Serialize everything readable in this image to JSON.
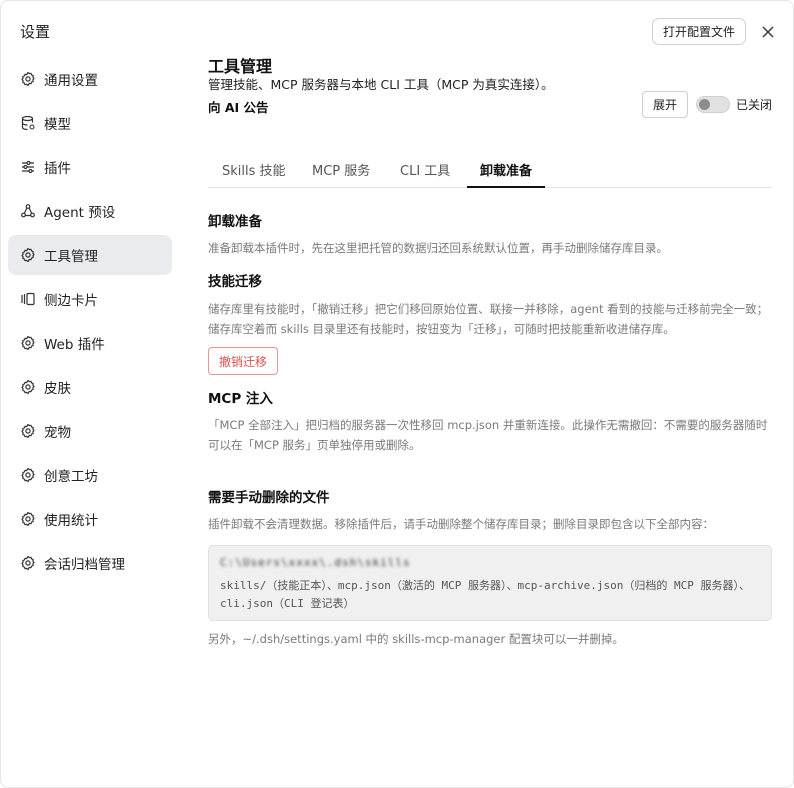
{
  "sidebar": {
    "title": "设置",
    "items": [
      {
        "label": "通用设置",
        "icon": "gear-icon"
      },
      {
        "label": "模型",
        "icon": "database-icon"
      },
      {
        "label": "插件",
        "icon": "sliders-icon"
      },
      {
        "label": "Agent 预设",
        "icon": "agent-icon"
      },
      {
        "label": "工具管理",
        "icon": "gear-icon"
      },
      {
        "label": "侧边卡片",
        "icon": "cards-icon"
      },
      {
        "label": "Web 插件",
        "icon": "gear-icon"
      },
      {
        "label": "皮肤",
        "icon": "gear-icon"
      },
      {
        "label": "宠物",
        "icon": "gear-icon"
      },
      {
        "label": "创意工坊",
        "icon": "gear-icon"
      },
      {
        "label": "使用统计",
        "icon": "gear-icon"
      },
      {
        "label": "会话归档管理",
        "icon": "gear-icon"
      }
    ],
    "active_index": 4
  },
  "header": {
    "open_config_label": "打开配置文件",
    "close_icon": "close-icon"
  },
  "main": {
    "title": "工具管理",
    "subtitle": "管理技能、MCP 服务器与本地 CLI 工具（MCP 为真实连接）。",
    "announce_label": "向 AI 公告",
    "expand_label": "展开",
    "toggle_label": "已关闭",
    "toggle_on": false,
    "tabs": [
      {
        "label": "Skills 技能"
      },
      {
        "label": "MCP 服务"
      },
      {
        "label": "CLI 工具"
      },
      {
        "label": "卸载准备"
      }
    ],
    "active_tab": 3
  },
  "content": {
    "section1_title": "卸载准备",
    "section1_text": "准备卸载本插件时，先在这里把托管的数据归还回系统默认位置，再手动删除储存库目录。",
    "section2_title": "技能迁移",
    "section2_text": "储存库里有技能时，「撤销迁移」把它们移回原始位置、联接一并移除，agent 看到的技能与迁移前完全一致；储存库空着而 skills 目录里还有技能时，按钮变为「迁移」，可随时把技能重新收进储存库。",
    "undo_button": "撤销迁移",
    "section3_title": "MCP 注入",
    "section3_text": "「MCP 全部注入」把归档的服务器一次性移回 mcp.json 并重新连接。此操作无需撤回：不需要的服务器随时可以在「MCP 服务」页单独停用或删除。",
    "section4_title": "需要手动删除的文件",
    "section4_text": "插件卸载不会清理数据。移除插件后，请手动删除整个储存库目录；删除目录即包含以下全部内容：",
    "code_path": "C:\\Users\\xxxx\\.dsh\\skills",
    "code_content": "skills/（技能正本）、mcp.json（激活的 MCP 服务器）、mcp-archive.json（归档的 MCP 服务器）、cli.json（CLI 登记表）",
    "footer_note": "另外，~/.dsh/settings.yaml 中的 skills-mcp-manager 配置块可以一并删掉。"
  }
}
